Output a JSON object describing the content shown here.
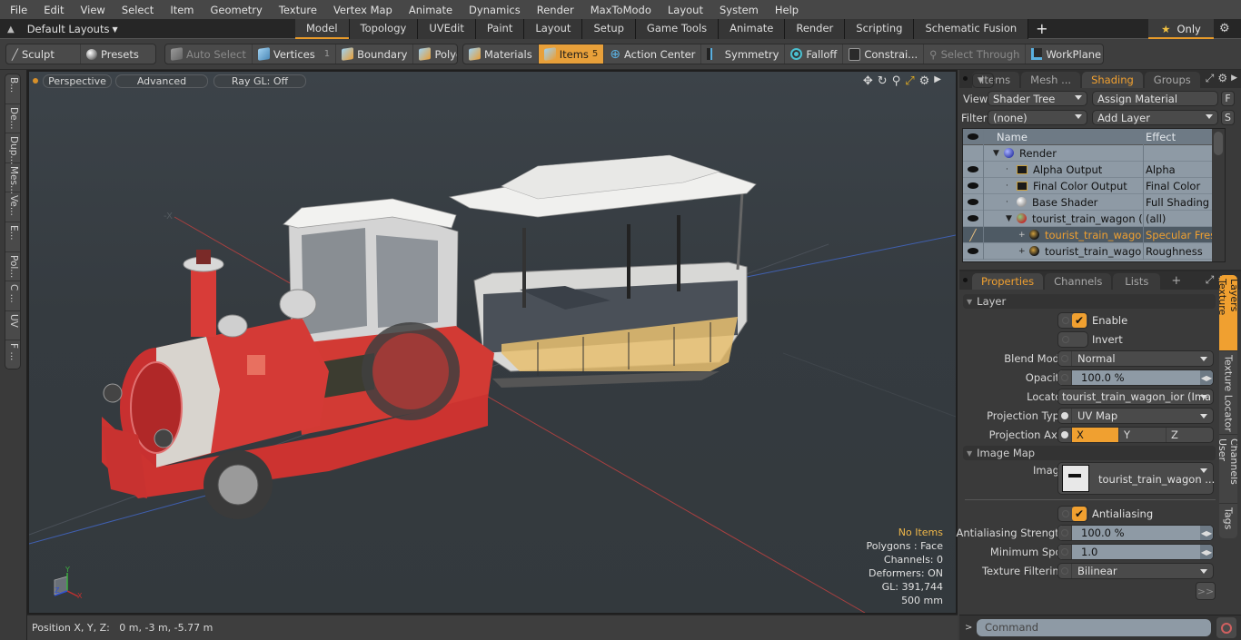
{
  "menu": [
    "File",
    "Edit",
    "View",
    "Select",
    "Item",
    "Geometry",
    "Texture",
    "Vertex Map",
    "Animate",
    "Dynamics",
    "Render",
    "MaxToModo",
    "Layout",
    "System",
    "Help"
  ],
  "layout_bar": {
    "layouts_dropdown": "Default Layouts",
    "tabs": [
      "Model",
      "Topology",
      "UVEdit",
      "Paint",
      "Layout",
      "Setup",
      "Game Tools",
      "Animate",
      "Render",
      "Scripting",
      "Schematic Fusion"
    ],
    "active_tab": "Model",
    "add_tab_icon": "+",
    "only_label": "Only",
    "star_icon": "★",
    "gear_icon": "⚙"
  },
  "toolbar": {
    "sculpt": "Sculpt",
    "presets": "Presets",
    "auto_select": "Auto Select",
    "vertices": "Vertices",
    "vertices_count": "1",
    "boundary": "Boundary",
    "polygons": "Polygons",
    "materials": "Materials",
    "items": "Items",
    "items_count": "5",
    "action_center": "Action Center",
    "symmetry": "Symmetry",
    "falloff": "Falloff",
    "constraints": "Constrai...",
    "select_through": "Select Through",
    "workplane": "WorkPlane"
  },
  "left_tabs": [
    "B...",
    "De...",
    "Dup...",
    "Mes...",
    "Ve...",
    "E...",
    "Pol...",
    "C ...",
    "UV",
    "F ..."
  ],
  "viewport": {
    "view_mode": "Perspective",
    "shading_mode": "Advanced",
    "raygl": "Ray GL: Off",
    "hud": {
      "selection": "No Items",
      "polygons": "Polygons : Face",
      "channels": "Channels: 0",
      "deformers": "Deformers: ON",
      "gl": "GL: 391,744",
      "scale": "500 mm"
    },
    "axis_labels": {
      "x": "X",
      "y": "Y",
      "z": "Z"
    }
  },
  "status_bar": {
    "position": "Position X, Y, Z:   0 m, -3 m, -5.77 m"
  },
  "shader_panel": {
    "tabs": [
      "Items",
      "Mesh ...",
      "Shading",
      "Groups"
    ],
    "active_tab": "Shading",
    "view_label": "View",
    "view_value": "Shader Tree",
    "assign_material": "Assign Material",
    "f_button": "F",
    "filter_label": "Filter",
    "filter_value": "(none)",
    "add_layer": "Add Layer",
    "s_button": "S",
    "columns": {
      "name": "Name",
      "effect": "Effect"
    },
    "rows": [
      {
        "name": "Render",
        "effect": "",
        "icon": "render-sphere",
        "indent": 0,
        "eye": false
      },
      {
        "name": "Alpha Output",
        "effect": "Alpha",
        "icon": "image-output",
        "indent": 1,
        "eye": true
      },
      {
        "name": "Final Color Output",
        "effect": "Final Color",
        "icon": "image-output",
        "indent": 1,
        "eye": true
      },
      {
        "name": "Base Shader",
        "effect": "Full Shading",
        "icon": "shader-sphere",
        "indent": 1,
        "eye": true
      },
      {
        "name": "tourist_train_wagon (...",
        "effect": "(all)",
        "icon": "material-group",
        "indent": 1,
        "eye": true
      },
      {
        "name": "tourist_train_wago ...",
        "effect": "Specular Fresn...",
        "icon": "texture-layer",
        "indent": 2,
        "eye": false,
        "selected": true
      },
      {
        "name": "tourist_train_wago ...",
        "effect": "Roughness",
        "icon": "texture-layer",
        "indent": 2,
        "eye": true
      }
    ]
  },
  "properties_panel": {
    "tabs": [
      "Properties",
      "Channels",
      "Lists"
    ],
    "active_tab": "Properties",
    "layer_section": "Layer",
    "enable_label": "Enable",
    "enable_checked": true,
    "invert_label": "Invert",
    "invert_checked": false,
    "blend_mode_label": "Blend Mode",
    "blend_mode_value": "Normal",
    "opacity_label": "Opacity",
    "opacity_value": "100.0 %",
    "locator_label": "Locator",
    "locator_value": "tourist_train_wagon_ior (Ima ...",
    "projection_type_label": "Projection Type",
    "projection_type_value": "UV Map",
    "projection_axis_label": "Projection Axis",
    "projection_axes": [
      "X",
      "Y",
      "Z"
    ],
    "projection_axis_selected": "X",
    "image_map_section": "Image Map",
    "image_label": "Image",
    "image_value": "tourist_train_wagon ...",
    "antialiasing_label": "Antialiasing",
    "antialiasing_checked": true,
    "aa_strength_label": "Antialiasing Strength",
    "aa_strength_value": "100.0 %",
    "min_spot_label": "Minimum Spot",
    "min_spot_value": "1.0",
    "tex_filter_label": "Texture Filtering",
    "tex_filter_value": "Bilinear",
    "more_button": ">>",
    "side_tabs": [
      "Texture Layers",
      "Texture Locator",
      "User Channels",
      "Tags"
    ],
    "active_side_tab": "Texture Layers"
  },
  "command_bar": {
    "prompt": ">",
    "placeholder": "Command"
  },
  "colors": {
    "accent": "#f0a030",
    "viewport_bg": "#353b40",
    "tree_bg": "#8e9aa5"
  }
}
